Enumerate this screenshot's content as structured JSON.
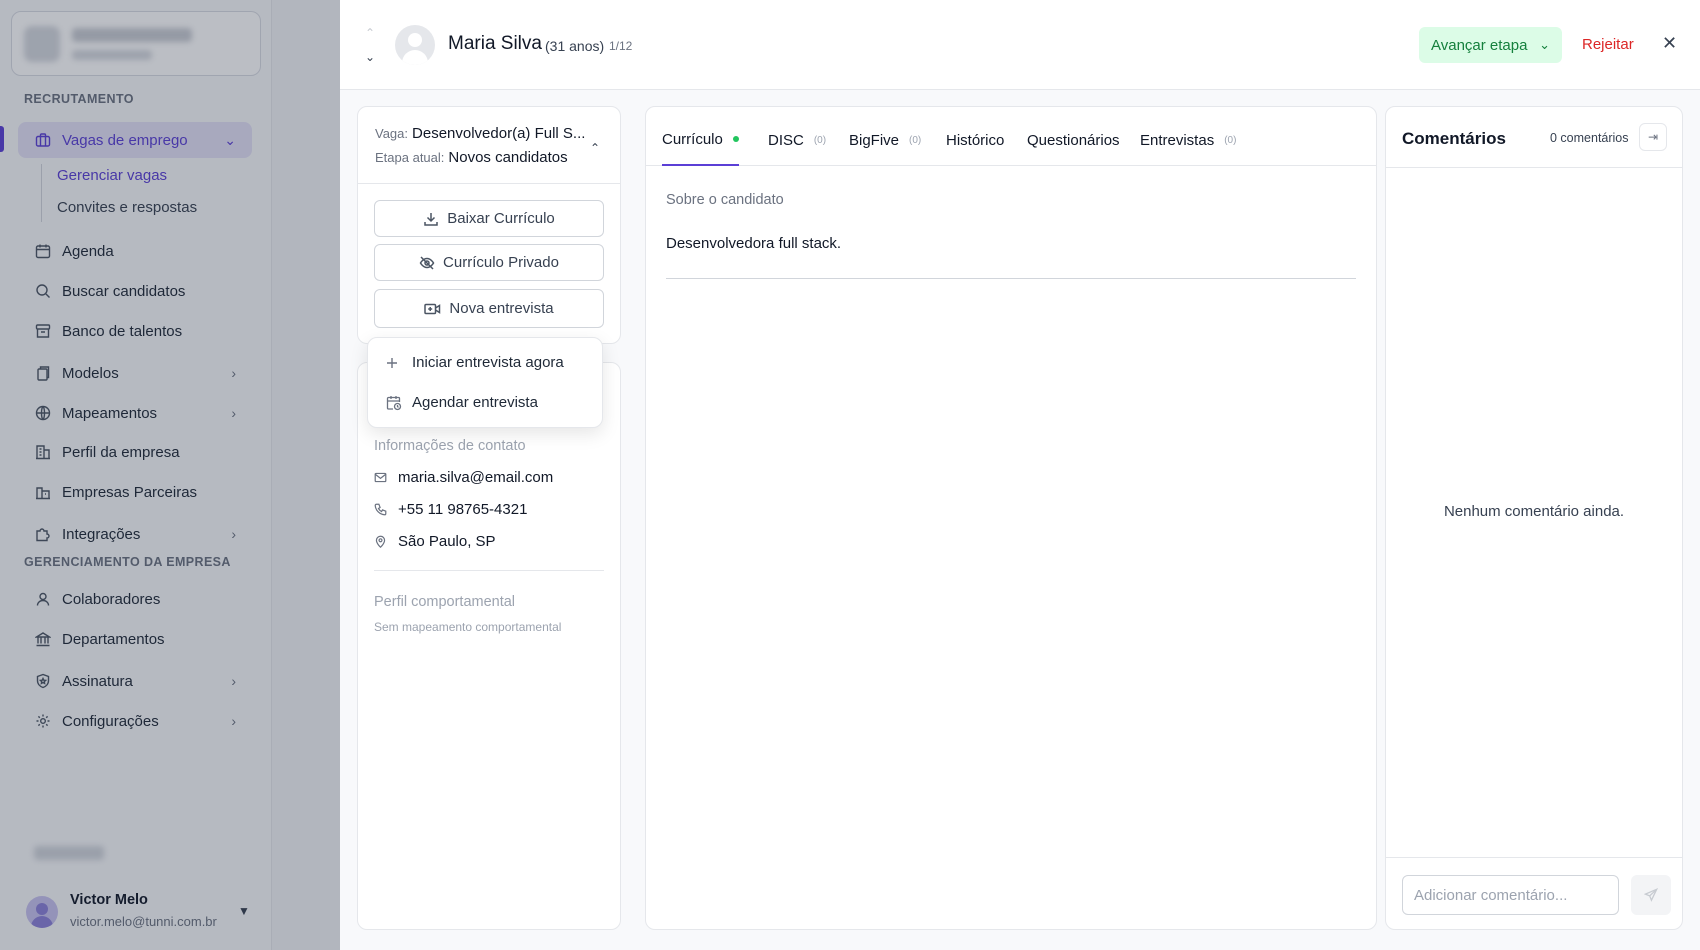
{
  "sidebar": {
    "sections": {
      "recruitment": "RECRUTAMENTO",
      "company": "GERENCIAMENTO DA EMPRESA"
    },
    "items": {
      "vagas": "Vagas de emprego",
      "gerenciar": "Gerenciar vagas",
      "convites": "Convites e respostas",
      "agenda": "Agenda",
      "buscar": "Buscar candidatos",
      "banco": "Banco de talentos",
      "modelos": "Modelos",
      "mapeamentos": "Mapeamentos",
      "perfil": "Perfil da empresa",
      "parceiras": "Empresas Parceiras",
      "integracoes": "Integrações",
      "colaboradores": "Colaboradores",
      "departamentos": "Departamentos",
      "assinatura": "Assinatura",
      "configuracoes": "Configurações"
    },
    "user": {
      "name": "Victor Melo",
      "email": "victor.melo@tunni.com.br"
    }
  },
  "header": {
    "candidate_name": "Maria Silva",
    "age": "(31 anos)",
    "position": "1/12",
    "advance_label": "Avançar etapa",
    "reject_label": "Rejeitar"
  },
  "job": {
    "vaga_label": "Vaga:",
    "vaga_value": "Desenvolvedor(a) Full S...",
    "etapa_label": "Etapa atual:",
    "etapa_value": "Novos candidatos"
  },
  "actions": {
    "download": "Baixar Currículo",
    "private": "Currículo Privado",
    "new_interview": "Nova entrevista"
  },
  "interview_menu": {
    "start_now": "Iniciar entrevista agora",
    "schedule": "Agendar entrevista"
  },
  "contact": {
    "title": "Informações de contato",
    "email": "maria.silva@email.com",
    "phone": "+55 11 98765-4321",
    "location": "São Paulo, SP"
  },
  "behavior": {
    "title": "Perfil comportamental",
    "subtitle": "Sem mapeamento comportamental"
  },
  "tabs": [
    {
      "label": "Currículo",
      "count": ""
    },
    {
      "label": "DISC",
      "count": "(0)"
    },
    {
      "label": "BigFive",
      "count": "(0)"
    },
    {
      "label": "Histórico",
      "count": ""
    },
    {
      "label": "Questionários",
      "count": ""
    },
    {
      "label": "Entrevistas",
      "count": "(0)"
    }
  ],
  "resume": {
    "about_title": "Sobre o candidato",
    "about_text": "Desenvolvedora full stack."
  },
  "comments": {
    "title": "Comentários",
    "count": "0 comentários",
    "empty": "Nenhum comentário ainda.",
    "placeholder": "Adicionar comentário..."
  },
  "colors": {
    "accent": "#5b3fd6",
    "advance_bg": "#dcfce7",
    "advance_text": "#15803d",
    "reject": "#dc2626",
    "status_dot": "#22c55e"
  }
}
